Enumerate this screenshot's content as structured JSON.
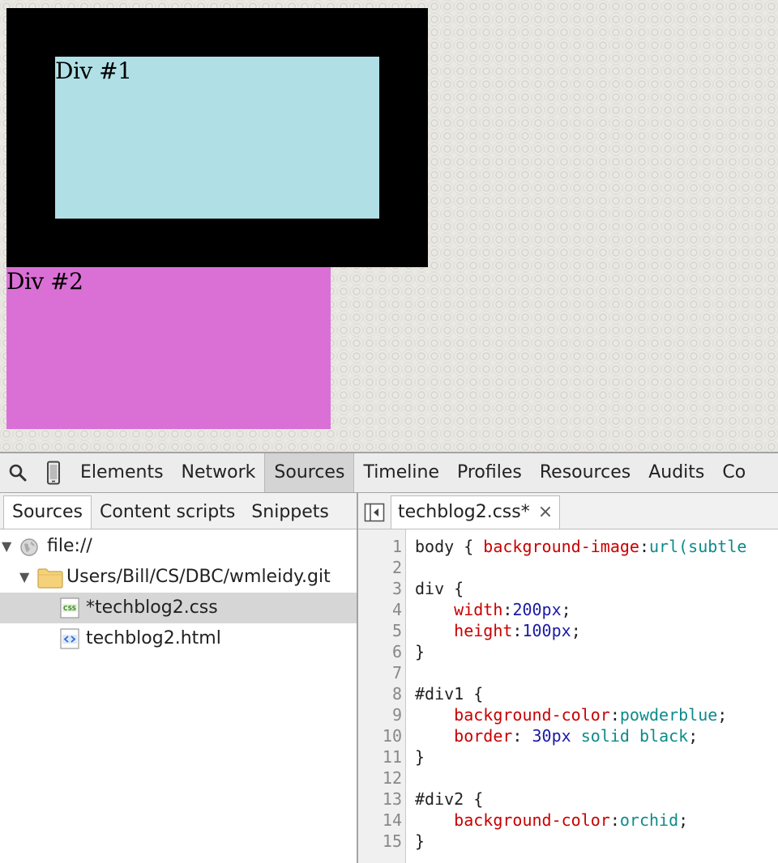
{
  "preview": {
    "div1_text": "Div #1",
    "div2_text": "Div #2",
    "colors": {
      "div1_bg": "#b0e0e6",
      "div1_border": "#000000",
      "div2_bg": "#da70d6"
    }
  },
  "devtools": {
    "toolbar": {
      "search_icon": "search-icon",
      "device_icon": "mobile-device-icon",
      "tabs": [
        "Elements",
        "Network",
        "Sources",
        "Timeline",
        "Profiles",
        "Resources",
        "Audits",
        "Co"
      ],
      "active_tab": "Sources"
    },
    "navigator": {
      "tabs": [
        "Sources",
        "Content scripts",
        "Snippets"
      ],
      "active_tab": "Sources",
      "tree": {
        "root": "file://",
        "folder": "Users/Bill/CS/DBC/wmleidy.git",
        "files": [
          "*techblog2.css",
          "techblog2.html"
        ],
        "selected_file": "*techblog2.css"
      }
    },
    "editor": {
      "open_tab": "techblog2.css*",
      "close_label": "×",
      "lines": [
        {
          "n": "1",
          "tokens": [
            [
              "body { ",
              "t"
            ],
            [
              "background-image",
              "prop"
            ],
            [
              ":",
              "t"
            ],
            [
              "url(subtle",
              "kw"
            ]
          ]
        },
        {
          "n": "2",
          "tokens": []
        },
        {
          "n": "3",
          "tokens": [
            [
              "div {",
              "t"
            ]
          ]
        },
        {
          "n": "4",
          "tokens": [
            [
              "    ",
              "t"
            ],
            [
              "width",
              "prop"
            ],
            [
              ":",
              "t"
            ],
            [
              "200px",
              "num"
            ],
            [
              ";",
              "t"
            ]
          ]
        },
        {
          "n": "5",
          "tokens": [
            [
              "    ",
              "t"
            ],
            [
              "height",
              "prop"
            ],
            [
              ":",
              "t"
            ],
            [
              "100px",
              "num"
            ],
            [
              ";",
              "t"
            ]
          ]
        },
        {
          "n": "6",
          "tokens": [
            [
              "}",
              "t"
            ]
          ]
        },
        {
          "n": "7",
          "tokens": []
        },
        {
          "n": "8",
          "tokens": [
            [
              "#div1 {",
              "t"
            ]
          ]
        },
        {
          "n": "9",
          "tokens": [
            [
              "    ",
              "t"
            ],
            [
              "background-color",
              "prop"
            ],
            [
              ":",
              "t"
            ],
            [
              "powderblue",
              "kw"
            ],
            [
              ";",
              "t"
            ]
          ]
        },
        {
          "n": "10",
          "tokens": [
            [
              "    ",
              "t"
            ],
            [
              "border",
              "prop"
            ],
            [
              ": ",
              "t"
            ],
            [
              "30px",
              "num"
            ],
            [
              " ",
              "t"
            ],
            [
              "solid black",
              "kw"
            ],
            [
              ";",
              "t"
            ]
          ]
        },
        {
          "n": "11",
          "tokens": [
            [
              "}",
              "t"
            ]
          ]
        },
        {
          "n": "12",
          "tokens": []
        },
        {
          "n": "13",
          "tokens": [
            [
              "#div2 {",
              "t"
            ]
          ]
        },
        {
          "n": "14",
          "tokens": [
            [
              "    ",
              "t"
            ],
            [
              "background-color",
              "prop"
            ],
            [
              ":",
              "t"
            ],
            [
              "orchid",
              "kw"
            ],
            [
              ";",
              "t"
            ]
          ]
        },
        {
          "n": "15",
          "tokens": [
            [
              "}",
              "t"
            ]
          ]
        }
      ]
    }
  }
}
